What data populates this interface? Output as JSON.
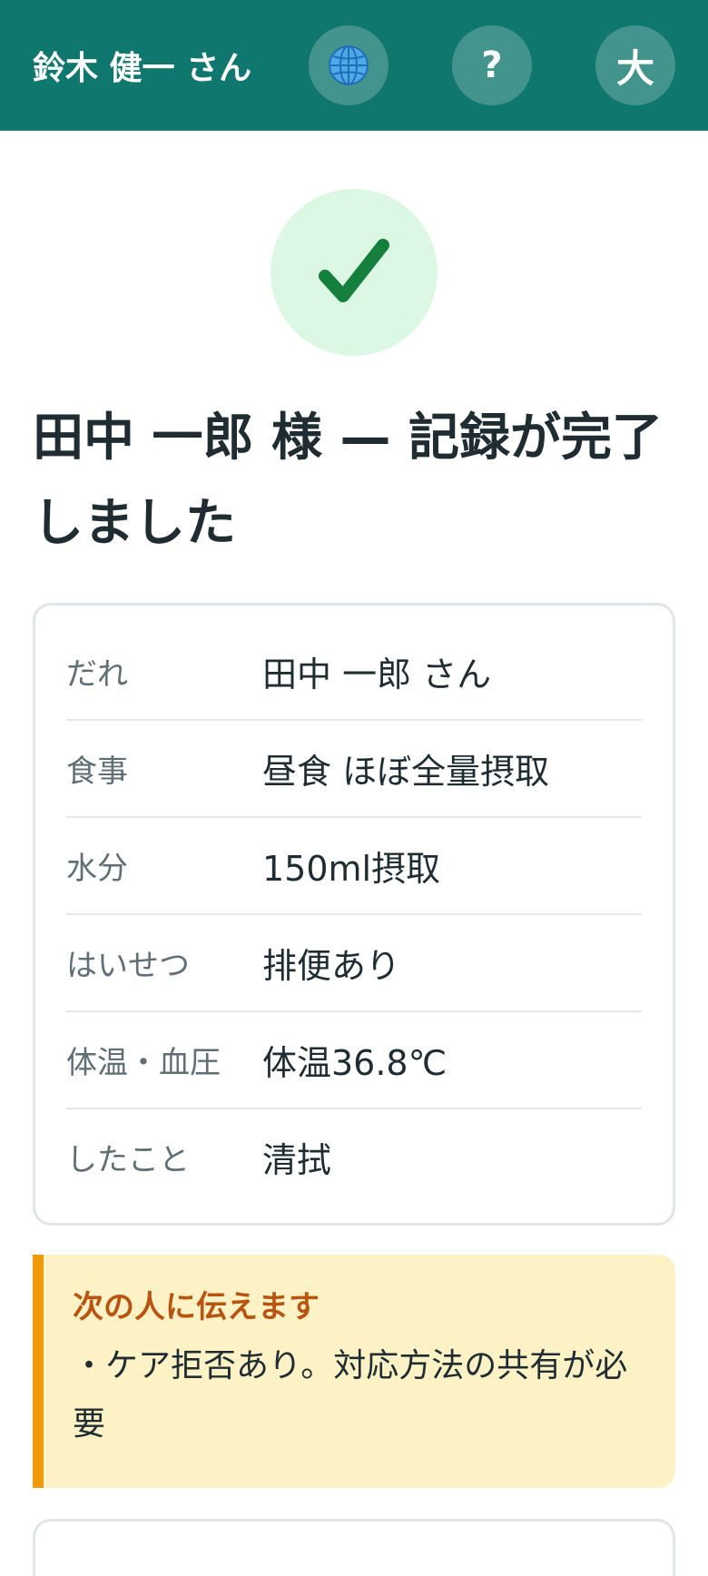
{
  "header": {
    "user_name": "鈴木 健一 さん",
    "globe_icon": "globe-icon",
    "help_label": "?",
    "font_size_label": "大",
    "background_color": "#10776f"
  },
  "status": {
    "icon": "check-icon",
    "title": "田中 一郎 様 — 記録が完了しました"
  },
  "record": {
    "rows": [
      {
        "label": "だれ",
        "value": "田中 一郎 さん"
      },
      {
        "label": "食事",
        "value": "昼食 ほぼ全量摂取"
      },
      {
        "label": "水分",
        "value": "150ml摂取"
      },
      {
        "label": "はいせつ",
        "value": "排便あり"
      },
      {
        "label": "体温・血圧",
        "value": "体温36.8℃"
      },
      {
        "label": "したこと",
        "value": "清拭"
      }
    ]
  },
  "handover": {
    "title": "次の人に伝えます",
    "body": "・ケア拒否あり。対応方法の共有が必要",
    "accent_color": "#f09a0e"
  }
}
